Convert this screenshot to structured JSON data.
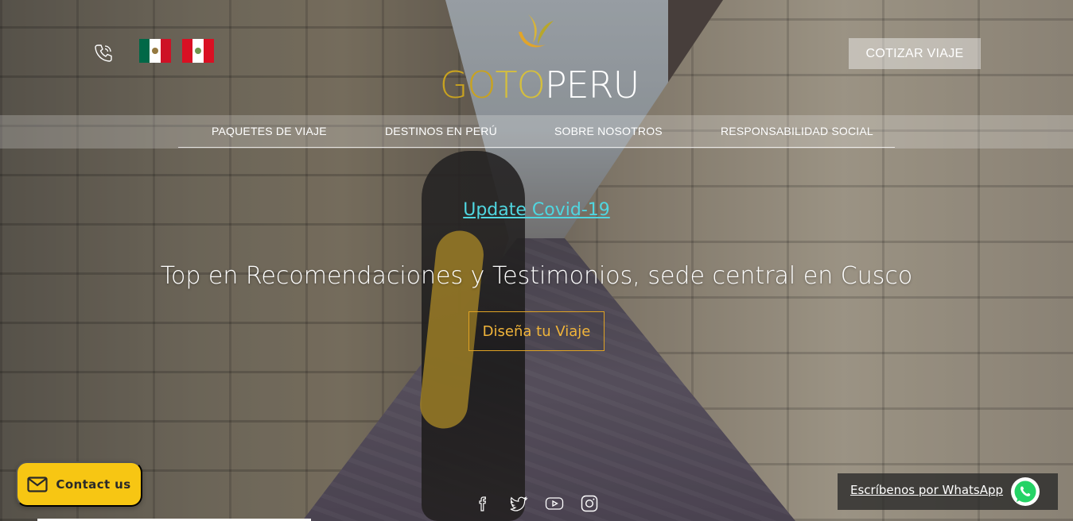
{
  "header": {
    "phone_icon": "phone-icon",
    "flags": [
      {
        "name": "mexico-flag",
        "colors": [
          "#006847",
          "#ffffff",
          "#ce1126"
        ]
      },
      {
        "name": "peru-flag",
        "colors": [
          "#d91023",
          "#ffffff",
          "#d91023"
        ]
      }
    ],
    "logo": {
      "part1": "GO",
      "part2": "TO",
      "part3": "PERU",
      "mark_icon": "wheat-leaf-icon"
    },
    "quote_button": "COTIZAR VIAJE"
  },
  "nav": {
    "items": [
      {
        "label": "PAQUETES DE VIAJE"
      },
      {
        "label": "DESTINOS EN PERÚ"
      },
      {
        "label": "SOBRE NOSOTROS"
      },
      {
        "label": "RESPONSABILIDAD SOCIAL"
      }
    ]
  },
  "hero": {
    "covid_link": "Update Covid-19",
    "title": "Top en Recomendaciones y Testimonios, sede central en Cusco",
    "cta": "Diseña tu Viaje"
  },
  "contact": {
    "label": "Contact us",
    "icon": "mail-icon"
  },
  "social": [
    "facebook-icon",
    "twitter-icon",
    "youtube-icon",
    "instagram-icon"
  ],
  "whatsapp": {
    "label": "Escríbenos por WhatsApp",
    "icon": "whatsapp-icon"
  },
  "colors": {
    "accent_gold": "#e0a324",
    "link_cyan": "#4fd6e0",
    "contact_yellow": "#f7c613",
    "whatsapp_green": "#25d366"
  }
}
